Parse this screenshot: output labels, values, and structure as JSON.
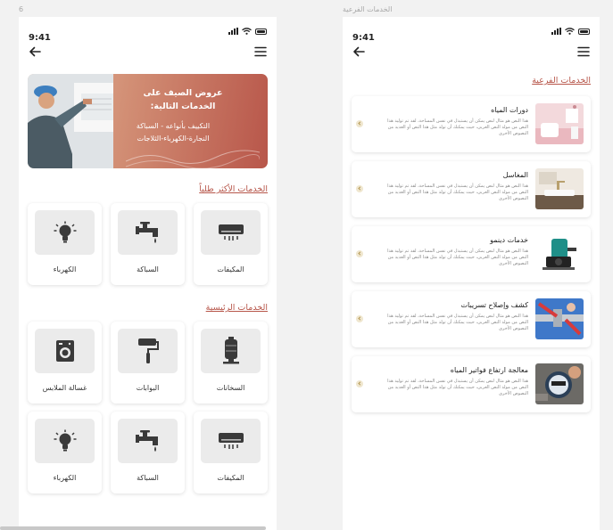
{
  "frames": {
    "left_label": "6",
    "right_label": "الخدمات الفرعية"
  },
  "status_bar": {
    "time": "9:41"
  },
  "home": {
    "banner": {
      "headline": "عروض الصيف على الخدمات التالية:",
      "services_line1": "التكييف بأنواعه - السباكة",
      "services_line2": "النجارة-الكهرباء-الثلاجات"
    },
    "popular_title": "الخدمات الأكثر طلباً",
    "popular": [
      {
        "label": "المكيفات",
        "icon": "air-conditioner-icon"
      },
      {
        "label": "السباكة",
        "icon": "faucet-icon"
      },
      {
        "label": "الكهرباء",
        "icon": "lightbulb-icon"
      }
    ],
    "main_title": "الخدمات الرئيسية",
    "main": [
      {
        "label": "السخانات",
        "icon": "water-heater-icon"
      },
      {
        "label": "البوابات",
        "icon": "paint-roller-icon"
      },
      {
        "label": "غسالة الملابس",
        "icon": "washing-machine-icon"
      },
      {
        "label": "المكيفات",
        "icon": "air-conditioner-icon"
      },
      {
        "label": "السباكة",
        "icon": "faucet-icon"
      },
      {
        "label": "الكهرباء",
        "icon": "lightbulb-icon"
      }
    ]
  },
  "subservices": {
    "title": "الخدمات الفرعية",
    "items": [
      {
        "name": "دورات المياه",
        "desc": "هذا النص هو مثال لنص يمكن أن يستبدل في نفس المساحة، لقد تم توليد هذا النص من مولد النص العربى، حيث يمكنك أن تولد مثل هذا النص أو العديد من النصوص الأخرى"
      },
      {
        "name": "المغاسل",
        "desc": "هذا النص هو مثال لنص يمكن أن يستبدل في نفس المساحة، لقد تم توليد هذا النص من مولد النص العربى، حيث يمكنك أن تولد مثل هذا النص أو العديد من النصوص الأخرى"
      },
      {
        "name": "خدمات دينمو",
        "desc": "هذا النص هو مثال لنص يمكن أن يستبدل في نفس المساحة، لقد تم توليد هذا النص من مولد النص العربى، حيث يمكنك أن تولد مثل هذا النص أو العديد من النصوص الأخرى"
      },
      {
        "name": "كشف وإصلاح تسريبات",
        "desc": "هذا النص هو مثال لنص يمكن أن يستبدل في نفس المساحة، لقد تم توليد هذا النص من مولد النص العربى، حيث يمكنك أن تولد مثل هذا النص أو العديد من النصوص الأخرى"
      },
      {
        "name": "معالجة ارتفاع فواتير المياه",
        "desc": "هذا النص هو مثال لنص يمكن أن يستبدل في نفس المساحة، لقد تم توليد هذا النص من مولد النص العربى، حيث يمكنك أن تولد مثل هذا النص أو العديد من النصوص الأخرى"
      }
    ]
  },
  "colors": {
    "accent": "#b7564a",
    "icon_tile": "#ebebeb",
    "arrow_badge": "#efe6cf"
  }
}
